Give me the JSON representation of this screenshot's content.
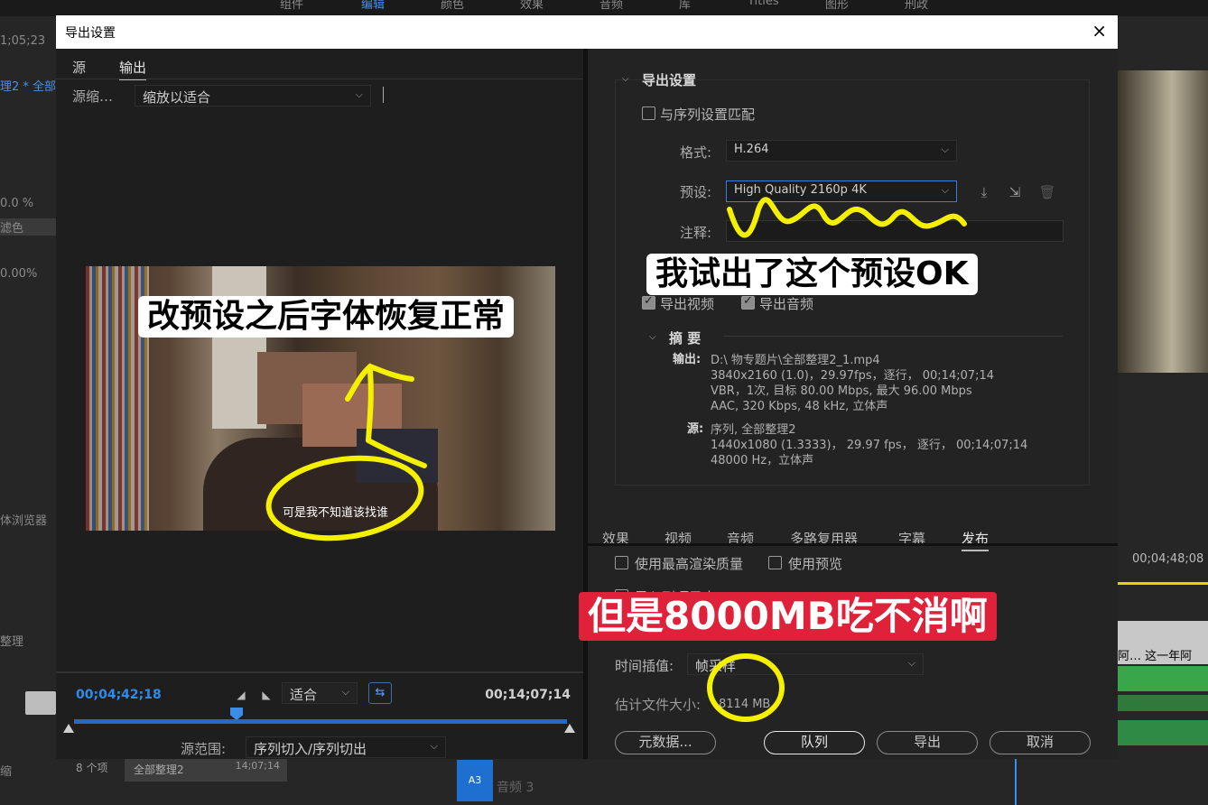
{
  "background": {
    "top_tabs": [
      "组件",
      "编辑",
      "颜色",
      "效果",
      "音频",
      "库",
      "Titles",
      "图形",
      "刑政"
    ],
    "left_timecode": "1;05;23",
    "left_project": "理2 * 全部",
    "left_percent1": "0.0 %",
    "left_filter": "滤色",
    "left_percent2": "0.00%",
    "left_browser": "体浏览器",
    "left_bin": "整理",
    "left_bottom": "缩",
    "items_count": "8 个项",
    "bin_item": "全部整理2",
    "bin_item_time": "14;07;14",
    "track": "A3",
    "track_name": "音频 3",
    "right_timecode": "00;04;48;08",
    "right_clip": "阿…   这一年阿"
  },
  "dialog": {
    "title": "导出设置",
    "close_icon": "×"
  },
  "left_panel": {
    "tabs": [
      "源",
      "输出"
    ],
    "active_tab": "输出",
    "source_scale_label": "源缩…",
    "source_scale_value": "缩放以适合",
    "preview_subtitle": "可是我不知道该找谁",
    "timecode_current": "00;04;42;18",
    "timecode_end": "00;14;07;14",
    "zoom_value": "适合",
    "source_range_label": "源范围:",
    "source_range_value": "序列切入/序列切出"
  },
  "right_panel": {
    "section_title": "导出设置",
    "match_sequence_label": "与序列设置匹配",
    "format_label": "格式:",
    "format_value": "H.264",
    "preset_label": "预设:",
    "preset_value": "High Quality 2160p 4K",
    "comment_label": "注释:",
    "export_video_label": "导出视频",
    "export_audio_label": "导出音频",
    "summary_title": "摘 要",
    "output_label": "输出:",
    "output_lines": [
      "D:\\         物专题片\\全部整理2_1.mp4",
      "3840x2160 (1.0)，29.97fps，逐行， 00;14;07;14",
      "VBR，1次, 目标 80.00 Mbps, 最大 96.00 Mbps",
      "AAC, 320 Kbps, 48  kHz, 立体声"
    ],
    "source_label": "源:",
    "source_lines": [
      "序列, 全部整理2",
      "1440x1080 (1.3333)， 29.97 fps， 逐行， 00;14;07;14",
      "48000 Hz，立体声"
    ],
    "tabs": [
      "效果",
      "视频",
      "音频",
      "多路复用器",
      "字幕",
      "发布"
    ],
    "active_tab": "发布",
    "max_render_label": "使用最高渲染质量",
    "use_preview_label": "使用预览",
    "import_project_label": "导入到项目中",
    "time_interp_label": "时间插值:",
    "time_interp_value": "帧采样",
    "est_size_label": "估计文件大小:",
    "est_size_value": "8114 MB",
    "buttons": {
      "metadata": "元数据...",
      "queue": "队列",
      "export": "导出",
      "cancel": "取消"
    }
  },
  "annotations": {
    "note_preset": "我试出了这个预设OK",
    "note_font": "改预设之后字体恢复正常",
    "note_size": "但是8000MB吃不消啊",
    "highlight_color": "#f5f000",
    "red_label_color": "#e0213a"
  }
}
